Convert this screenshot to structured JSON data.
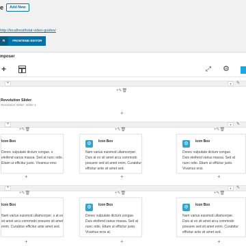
{
  "header": {
    "title_fragment": "e",
    "add_new_label": "Add New"
  },
  "permalink": {
    "url": "http://localhost/total-video-guides/"
  },
  "editor_tabs": {
    "backend": "R",
    "frontend": "FRONTEND EDITOR"
  },
  "composer": {
    "title": "mposer"
  },
  "icons": {
    "add": "+",
    "pencil": "✎",
    "chevron": "▾",
    "fullscreen": "⤢",
    "settings": "⚙",
    "trash": "🗑",
    "icon_box": "⚙"
  },
  "controls": {
    "col_ctrl": "+✎🗑",
    "plus": "+"
  },
  "slider": {
    "title": "Revolution Slider",
    "subtitle": "Revolution Slider: Slider 1"
  },
  "rows": [
    {
      "cards": [
        {
          "name": "Icon Box",
          "text": "Donec vulputate dictum congue. s eleifend varius massa. Sed at nunc odio. Etiam ut efficitur justo. Vivamus eros"
        },
        {
          "name": "Icon Box",
          "text": "Nam varius euismod ullamcorper. Duis at ex sit amet arcu commodo posuere sed sit amet enim. Curabitur efficitur ante sit amet sed."
        },
        {
          "name": "Icon Box",
          "text": "Donec vulputate dictum congue. Duis eleifend varius massa. Sed at nunc odio. Etiam ut efficitur justo. Vivamus erat."
        }
      ]
    },
    {
      "cards": [
        {
          "name": "Icon Box",
          "text": "Nam varius euismod ullamcorper. s at ex sit amet arcu commodo posuere sit amet enim. Curabitur efficitur ante amet sed."
        },
        {
          "name": "Icon Box",
          "text": "Donec vulputate dictum congue. Duis eleifend varius massa. Sed at nunc odio. Etiam ut efficitur justo. Vivamus eros at."
        },
        {
          "name": "Icon Box",
          "text": "Nam varius euismod ullamcorper. Duis at ex sit amet arcu commodo posuere sed sit amet enim. Curabitur efficitur ante sit amet sed."
        }
      ]
    }
  ],
  "colors": {
    "primary": "#0073aa",
    "primary_dark": "#0d5a7f",
    "icon_blue": "#2aa7d7",
    "accent": "#1ea7dc"
  }
}
